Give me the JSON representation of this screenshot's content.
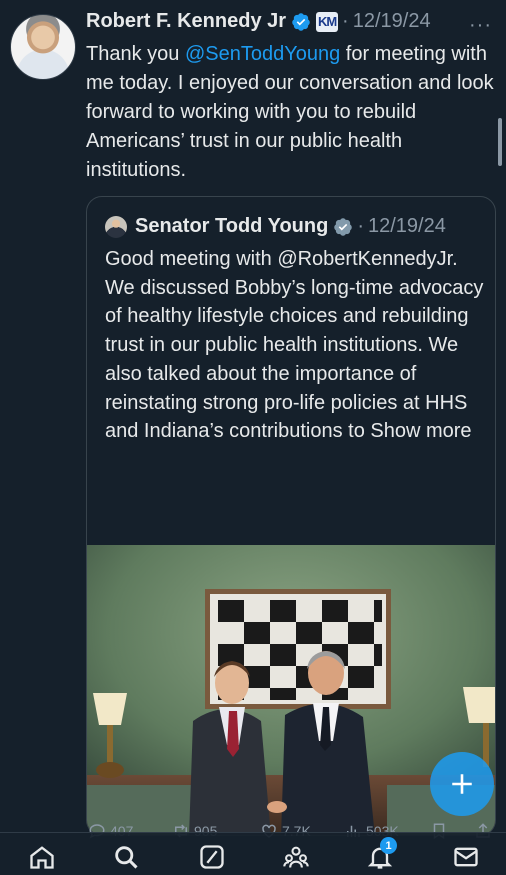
{
  "tweet": {
    "author_name": "Robert F. Kennedy Jr",
    "badge_text": "KM",
    "separator": "·",
    "date": "12/19/24",
    "more_label": "···",
    "text_before": "Thank you ",
    "mention": "@SenToddYoung",
    "text_after": " for meeting with me today. I enjoyed our conversation and look forward to working with you to rebuild Americans’ trust in our public health institutions."
  },
  "quote": {
    "author_name": "Senator Todd Young",
    "separator": "·",
    "date": "12/19/24",
    "text": "Good meeting with @RobertKennedyJr. We discussed Bobby’s long-time advocacy of healthy lifestyle choices and rebuilding trust in our public health institutions. We also talked about the importance of reinstating strong pro-life policies at HHS and Indiana’s contributions to Show more"
  },
  "actions": {
    "replies": "407",
    "reposts": "905",
    "likes": "7.7K",
    "views": "503K"
  },
  "nav": {
    "notification_count": "1"
  },
  "icons": {
    "verified": "verified-check-icon",
    "reply": "reply-icon",
    "repost": "repost-icon",
    "like": "heart-icon",
    "views": "views-icon",
    "bookmark": "bookmark-icon",
    "share": "share-icon",
    "compose": "plus-icon",
    "home": "home-icon",
    "search": "search-icon",
    "grok": "grok-icon",
    "communities": "communities-icon",
    "notifications": "bell-icon",
    "messages": "mail-icon"
  },
  "colors": {
    "background": "#15202b",
    "accent": "#1d9bf0",
    "muted": "#8b98a5"
  }
}
